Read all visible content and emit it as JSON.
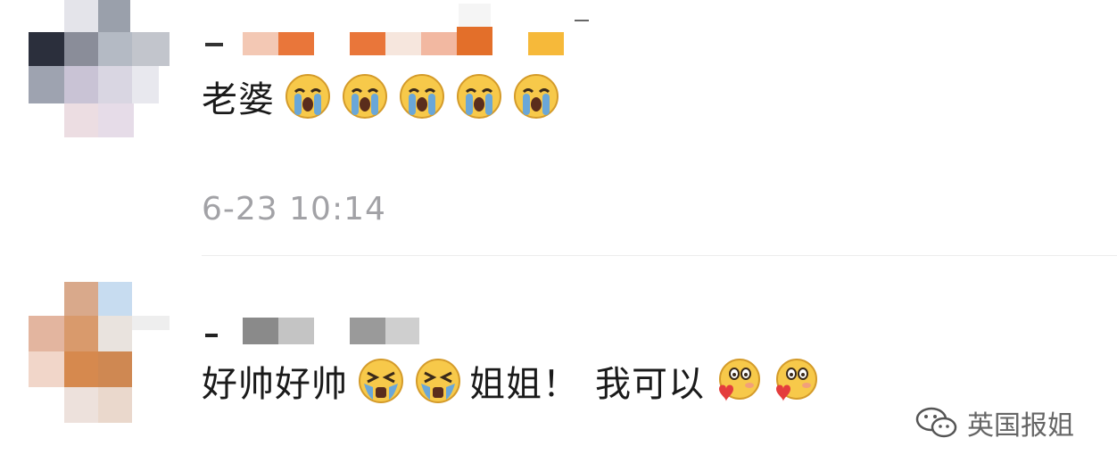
{
  "comments": [
    {
      "text_1": "老婆",
      "emojis": [
        "loudly-crying-face",
        "loudly-crying-face",
        "loudly-crying-face",
        "loudly-crying-face",
        "loudly-crying-face"
      ],
      "timestamp": "6-23 10:14"
    },
    {
      "text_1": "好帅好帅",
      "emojis_1": [
        "tearful-squint-face",
        "tearful-squint-face"
      ],
      "text_2": "姐姐！",
      "text_3": "我可以",
      "emojis_2": [
        "blushing-heart-face",
        "blushing-heart-face"
      ]
    }
  ],
  "watermark": {
    "text": "英国报姐",
    "icon": "wechat-icon"
  },
  "colors": {
    "text": "#1a1a1a",
    "timestamp": "#a2a2a6",
    "divider": "#ececec",
    "emoji_face": "#f7c94a",
    "emoji_tear": "#6aa7d8"
  }
}
